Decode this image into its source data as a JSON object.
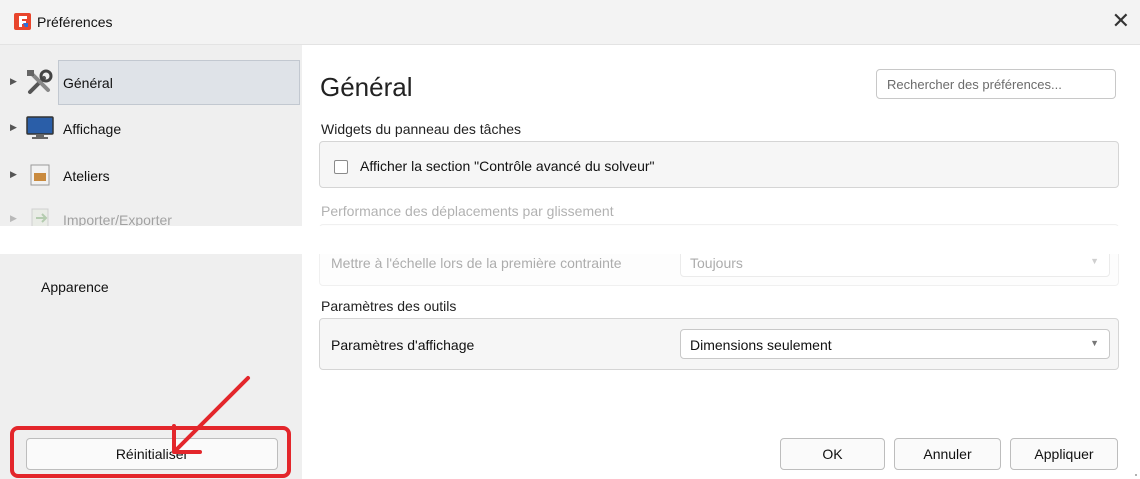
{
  "window": {
    "title": "Préférences",
    "close_symbol": "✕"
  },
  "sidebar": {
    "items": [
      {
        "label": "Général",
        "icon": "tools-icon"
      },
      {
        "label": "Affichage",
        "icon": "monitor-icon"
      },
      {
        "label": "Ateliers",
        "icon": "box-icon"
      },
      {
        "label": "Importer/Exporter",
        "icon": "import-export-icon"
      },
      {
        "label": "Apparence"
      }
    ],
    "reset_button": "Réinitialiser"
  },
  "main": {
    "title": "Général",
    "search_placeholder": "Rechercher des préférences...",
    "sections": {
      "widgets": {
        "title": "Widgets du panneau des tâches",
        "checkbox_label": "Afficher la section \"Contrôle avancé du solveur\"",
        "checked": false
      },
      "drag": {
        "title": "Performance des déplacements par glissement",
        "row_label": "Mettre à l'échelle lors de la première contrainte",
        "value": "Toujours"
      },
      "tools": {
        "title": "Paramètres des outils",
        "row_label": "Paramètres d'affichage",
        "value": "Dimensions seulement"
      }
    }
  },
  "buttons": {
    "ok": "OK",
    "cancel": "Annuler",
    "apply": "Appliquer"
  },
  "colors": {
    "highlight": "#e3262b",
    "app_icon": "#e8452c",
    "selected_bg": "#dfe3e8"
  }
}
